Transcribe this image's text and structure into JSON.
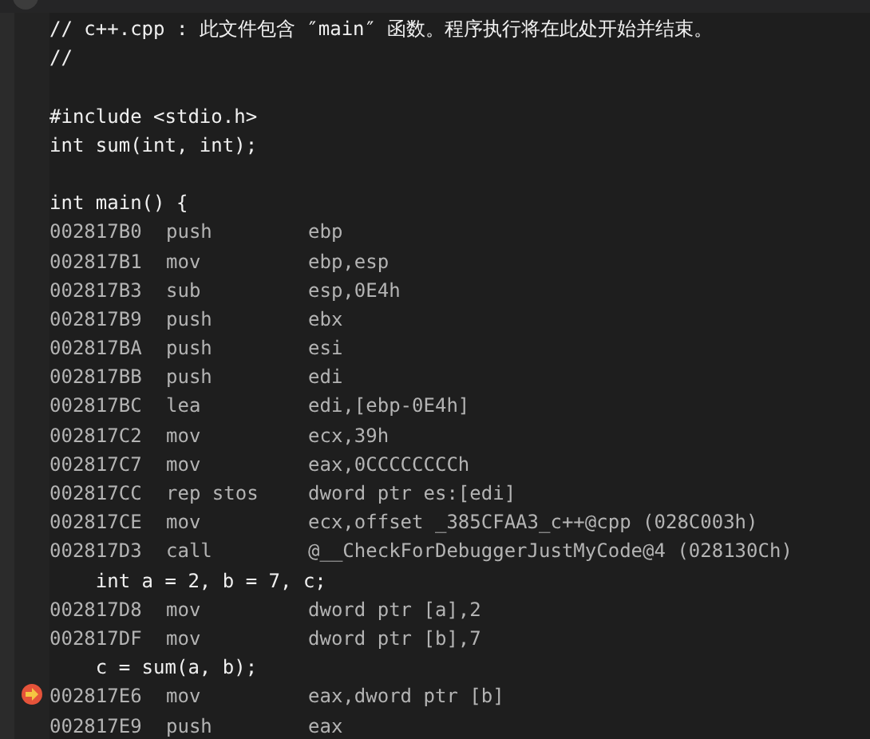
{
  "lines": [
    {
      "kind": "source",
      "text": "// c++.cpp : 此文件包含 ″main″ 函数。程序执行将在此处开始并结束。"
    },
    {
      "kind": "source",
      "text": "//"
    },
    {
      "kind": "blank"
    },
    {
      "kind": "source",
      "text": "#include <stdio.h>"
    },
    {
      "kind": "source",
      "text": "int sum(int, int);"
    },
    {
      "kind": "blank"
    },
    {
      "kind": "source",
      "text": "int main() {"
    },
    {
      "kind": "asm",
      "address": "002817B0",
      "mnemonic": "push",
      "operands": "ebp",
      "current": false
    },
    {
      "kind": "asm",
      "address": "002817B1",
      "mnemonic": "mov",
      "operands": "ebp,esp",
      "current": false
    },
    {
      "kind": "asm",
      "address": "002817B3",
      "mnemonic": "sub",
      "operands": "esp,0E4h",
      "current": false
    },
    {
      "kind": "asm",
      "address": "002817B9",
      "mnemonic": "push",
      "operands": "ebx",
      "current": false
    },
    {
      "kind": "asm",
      "address": "002817BA",
      "mnemonic": "push",
      "operands": "esi",
      "current": false
    },
    {
      "kind": "asm",
      "address": "002817BB",
      "mnemonic": "push",
      "operands": "edi",
      "current": false
    },
    {
      "kind": "asm",
      "address": "002817BC",
      "mnemonic": "lea",
      "operands": "edi,[ebp-0E4h]",
      "current": false
    },
    {
      "kind": "asm",
      "address": "002817C2",
      "mnemonic": "mov",
      "operands": "ecx,39h",
      "current": false
    },
    {
      "kind": "asm",
      "address": "002817C7",
      "mnemonic": "mov",
      "operands": "eax,0CCCCCCCCh",
      "current": false
    },
    {
      "kind": "asm",
      "address": "002817CC",
      "mnemonic": "rep stos",
      "operands": "dword ptr es:[edi]",
      "current": false
    },
    {
      "kind": "asm",
      "address": "002817CE",
      "mnemonic": "mov",
      "operands": "ecx,offset _385CFAA3_c++@cpp (028C003h)",
      "current": false
    },
    {
      "kind": "asm",
      "address": "002817D3",
      "mnemonic": "call",
      "operands": "@__CheckForDebuggerJustMyCode@4 (028130Ch)",
      "current": false
    },
    {
      "kind": "source",
      "text": "    int a = 2, b = 7, c;"
    },
    {
      "kind": "asm",
      "address": "002817D8",
      "mnemonic": "mov",
      "operands": "dword ptr [a],2",
      "current": false
    },
    {
      "kind": "asm",
      "address": "002817DF",
      "mnemonic": "mov",
      "operands": "dword ptr [b],7",
      "current": false
    },
    {
      "kind": "source",
      "text": "    c = sum(a, b);"
    },
    {
      "kind": "asm",
      "address": "002817E6",
      "mnemonic": "mov",
      "operands": "eax,dword ptr [b]",
      "current": true
    },
    {
      "kind": "asm",
      "address": "002817E9",
      "mnemonic": "push",
      "operands": "eax",
      "current": false
    }
  ]
}
